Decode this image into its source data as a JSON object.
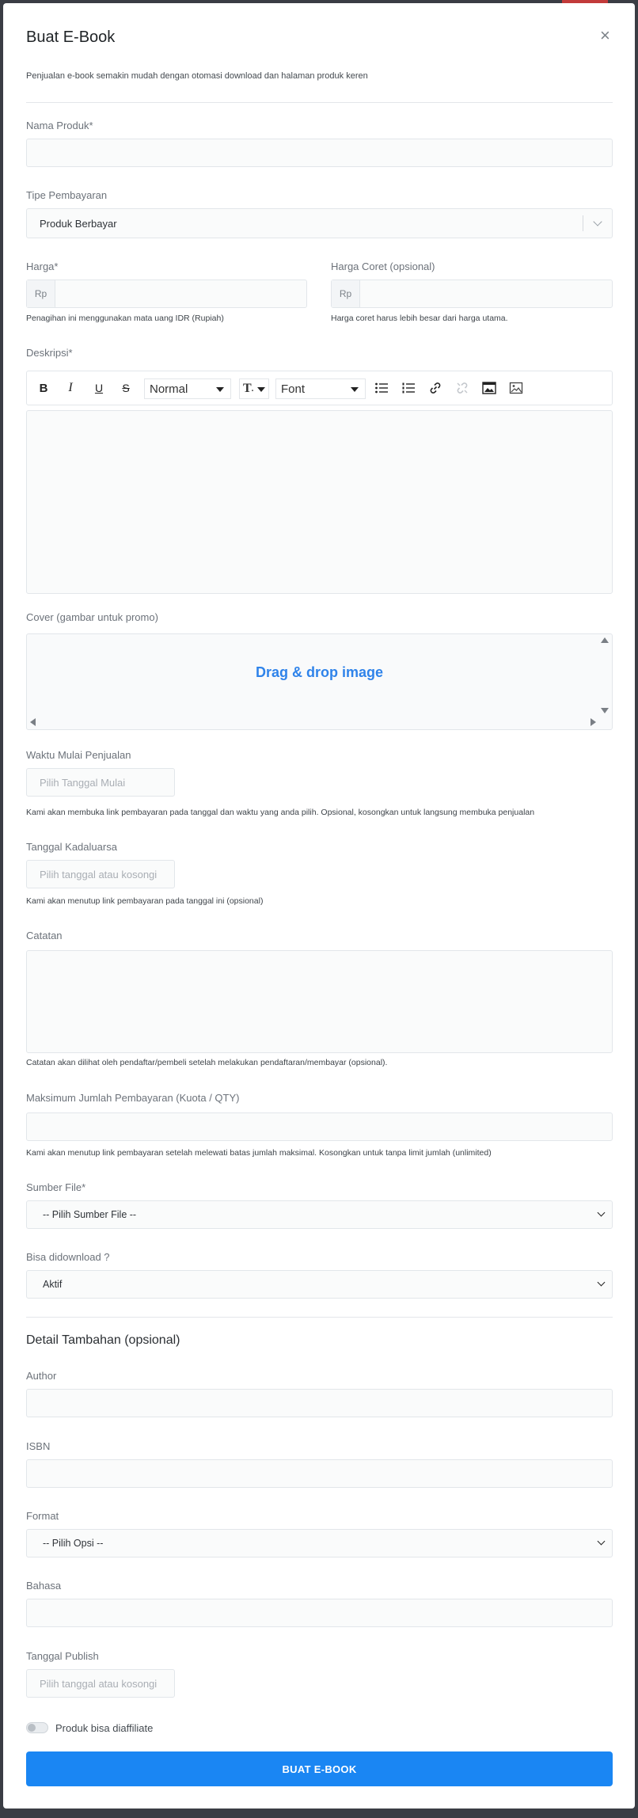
{
  "modal": {
    "title": "Buat E-Book",
    "subtitle": "Penjualan e-book semakin mudah dengan otomasi download dan halaman produk keren",
    "close_glyph": "×"
  },
  "nama_produk": {
    "label": "Nama Produk*",
    "value": ""
  },
  "tipe_pembayaran": {
    "label": "Tipe Pembayaran",
    "value": "Produk Berbayar"
  },
  "harga": {
    "label": "Harga*",
    "prefix": "Rp",
    "value": "",
    "hint": "Penagihan ini menggunakan mata uang IDR (Rupiah)"
  },
  "harga_coret": {
    "label": "Harga Coret (opsional)",
    "prefix": "Rp",
    "value": "",
    "hint": "Harga coret harus lebih besar dari harga utama."
  },
  "deskripsi": {
    "label": "Deskripsi*",
    "toolbar": {
      "bold": "B",
      "italic": "I",
      "underline": "U",
      "strike": "S",
      "heading": "Normal",
      "size": "T",
      "font": "Font",
      "icons": [
        "bold-icon",
        "italic-icon",
        "underline-icon",
        "strikethrough-icon",
        "text-size-icon",
        "bulleted-list-icon",
        "numbered-list-icon",
        "link-icon",
        "unlink-icon",
        "picture-icon",
        "image-icon"
      ]
    },
    "value": ""
  },
  "cover": {
    "label": "Cover (gambar untuk promo)",
    "dropzone_text": "Drag & drop image"
  },
  "waktu_mulai": {
    "label": "Waktu Mulai Penjualan",
    "placeholder": "Pilih Tanggal Mulai",
    "hint": "Kami akan membuka link pembayaran pada tanggal dan waktu yang anda pilih. Opsional, kosongkan untuk langsung membuka penjualan"
  },
  "tanggal_kadaluarsa": {
    "label": "Tanggal Kadaluarsa",
    "placeholder": "Pilih tanggal atau kosongi",
    "hint": "Kami akan menutup link pembayaran pada tanggal ini (opsional)"
  },
  "catatan": {
    "label": "Catatan",
    "value": "",
    "hint": "Catatan akan dilihat oleh pendaftar/pembeli setelah melakukan pendaftaran/membayar (opsional)."
  },
  "kuota": {
    "label": "Maksimum Jumlah Pembayaran (Kuota / QTY)",
    "value": "",
    "hint": "Kami akan menutup link pembayaran setelah melewati batas jumlah maksimal. Kosongkan untuk tanpa limit jumlah (unlimited)"
  },
  "sumber_file": {
    "label": "Sumber File*",
    "value": "-- Pilih Sumber File --"
  },
  "bisa_didownload": {
    "label": "Bisa didownload ?",
    "value": "Aktif"
  },
  "detail_tambahan": {
    "heading": "Detail Tambahan (opsional)",
    "author": {
      "label": "Author",
      "value": ""
    },
    "isbn": {
      "label": "ISBN",
      "value": ""
    },
    "format": {
      "label": "Format",
      "value": "-- Pilih Opsi --"
    },
    "bahasa": {
      "label": "Bahasa",
      "value": ""
    },
    "tanggal_publish": {
      "label": "Tanggal Publish",
      "placeholder": "Pilih tanggal atau kosongi"
    }
  },
  "affiliate": {
    "label": "Produk bisa diaffiliate",
    "enabled": false
  },
  "submit": {
    "label": "BUAT E-BOOK"
  },
  "colors": {
    "primary": "#1a86f3",
    "link_blue": "#2f83ea",
    "backdrop": "#3a3d44"
  }
}
